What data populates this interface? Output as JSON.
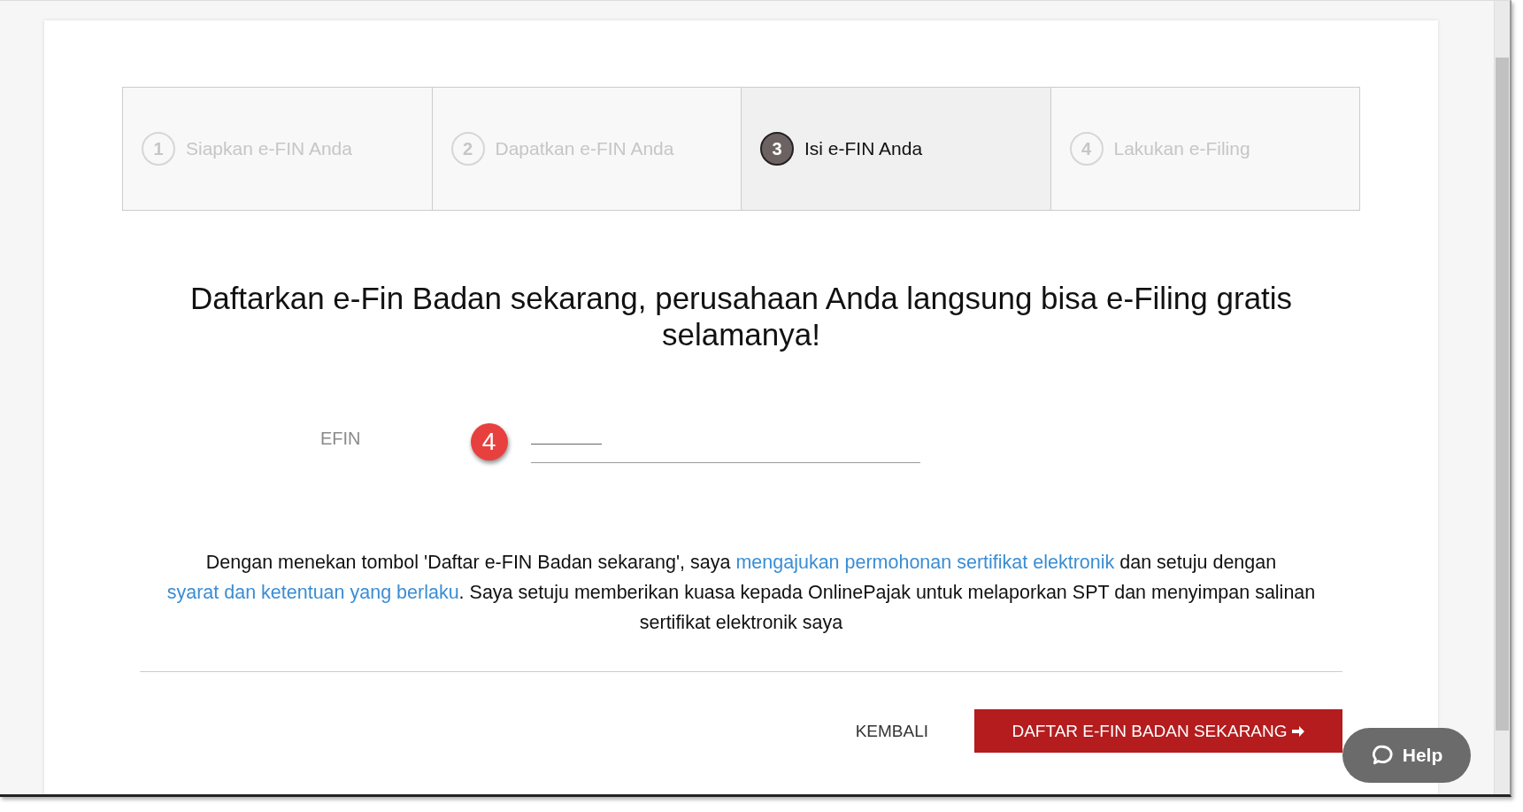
{
  "steps": [
    {
      "number": "1",
      "label": "Siapkan e-FIN Anda",
      "selected": false
    },
    {
      "number": "2",
      "label": "Dapatkan e-FIN Anda",
      "selected": false
    },
    {
      "number": "3",
      "label": "Isi e-FIN Anda",
      "selected": true
    },
    {
      "number": "4",
      "label": "Lakukan e-Filing",
      "selected": false
    }
  ],
  "heading": "Daftarkan e-Fin Badan sekarang, perusahaan Anda langsung bisa e-Filing gratis selamanya!",
  "form": {
    "label": "EFIN",
    "callout": "4"
  },
  "consent": [
    {
      "kind": "text",
      "text": "Dengan menekan tombol 'Daftar e-FIN Badan sekarang', saya "
    },
    {
      "kind": "link",
      "text": "mengajukan permohonan sertifikat elektronik"
    },
    {
      "kind": "text",
      "text": " dan setuju dengan "
    },
    {
      "kind": "link",
      "text": "syarat dan ketentuan yang berlaku"
    },
    {
      "kind": "text",
      "text": ". Saya setuju memberikan kuasa kepada OnlinePajak untuk melaporkan SPT dan menyimpan salinan sertifikat elektronik saya"
    }
  ],
  "buttons": {
    "back": "KEMBALI",
    "submit": "DAFTAR E-FIN BADAN SEKARANG"
  },
  "help": "Help"
}
